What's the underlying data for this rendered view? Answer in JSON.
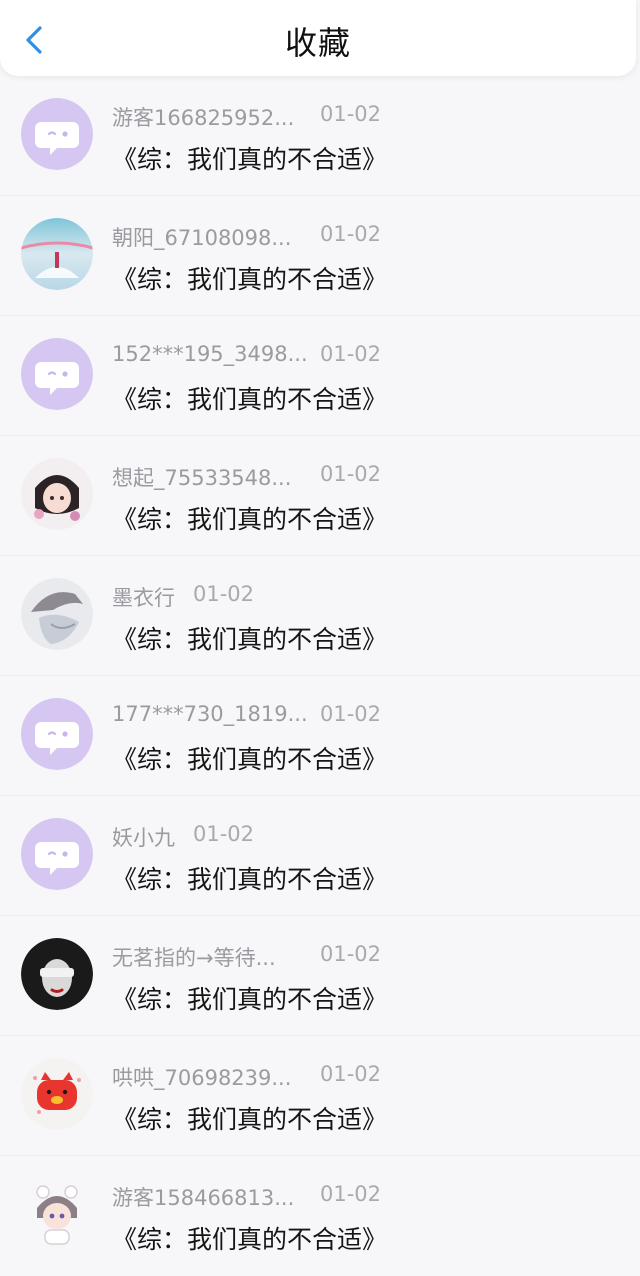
{
  "header": {
    "title": "收藏"
  },
  "colors": {
    "accent": "#2f8fe6",
    "default_avatar": "#d6c6f2"
  },
  "items": [
    {
      "name": "游客166825952...",
      "date": "01-02",
      "title": "《综：我们真的不合适》",
      "avatar": "default-chat-avatar"
    },
    {
      "name": "朝阳_67108098...",
      "date": "01-02",
      "title": "《综：我们真的不合适》",
      "avatar": "scenery-avatar"
    },
    {
      "name": "152***195_3498...",
      "date": "01-02",
      "title": "《综：我们真的不合适》",
      "avatar": "default-chat-avatar"
    },
    {
      "name": "想起_75533548...",
      "date": "01-02",
      "title": "《综：我们真的不合适》",
      "avatar": "anime-avatar"
    },
    {
      "name": "墨衣行",
      "date": "01-02",
      "title": "《综：我们真的不合适》",
      "avatar": "hooded-avatar"
    },
    {
      "name": "177***730_1819...",
      "date": "01-02",
      "title": "《综：我们真的不合适》",
      "avatar": "default-chat-avatar"
    },
    {
      "name": "妖小九",
      "date": "01-02",
      "title": "《综：我们真的不合适》",
      "avatar": "default-chat-avatar"
    },
    {
      "name": "无茗指的→等待...",
      "date": "01-02",
      "title": "《综：我们真的不合适》",
      "avatar": "blindfold-avatar"
    },
    {
      "name": "哄哄_70698239...",
      "date": "01-02",
      "title": "《综：我们真的不合适》",
      "avatar": "pig-avatar"
    },
    {
      "name": "游客158466813...",
      "date": "01-02",
      "title": "《综：我们真的不合适》",
      "avatar": "chibi-avatar"
    }
  ]
}
